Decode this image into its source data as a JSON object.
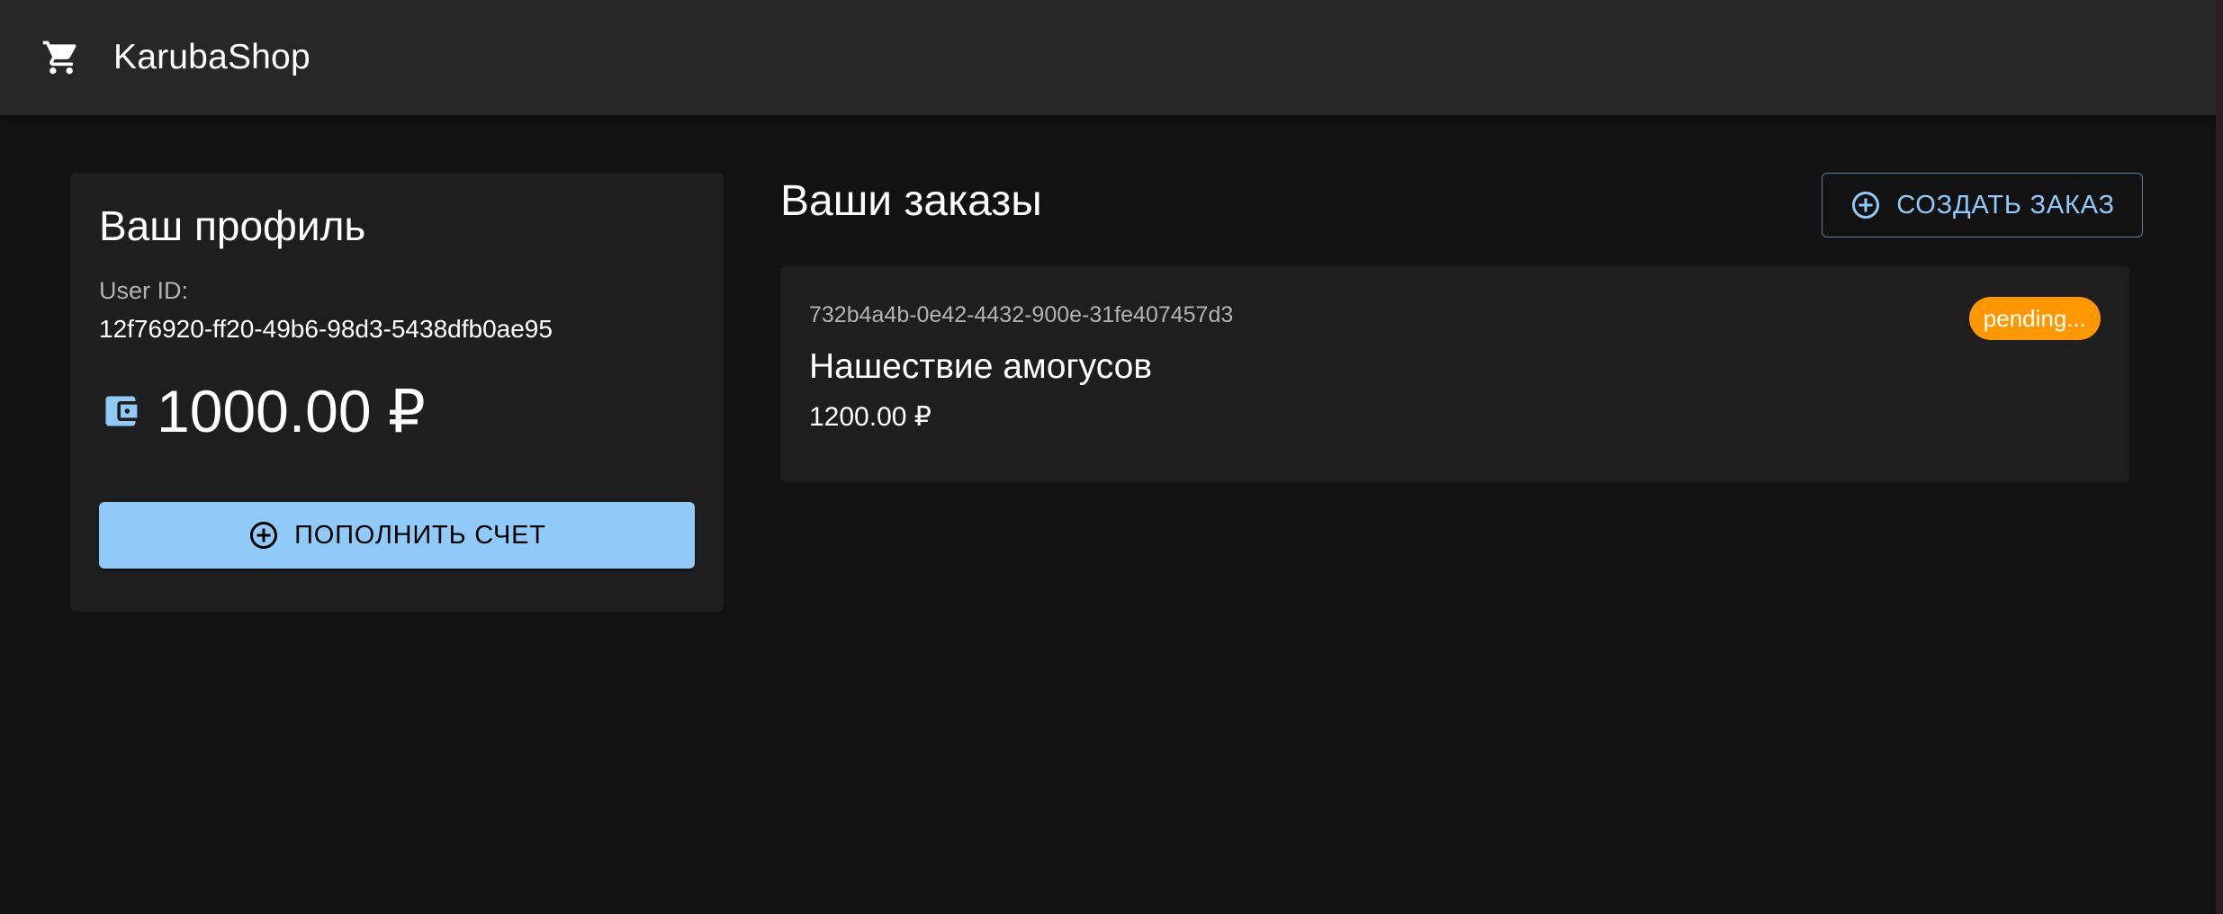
{
  "app": {
    "title": "KarubaShop",
    "icon": "shopping-cart-icon"
  },
  "profile": {
    "heading": "Ваш профиль",
    "user_id_label": "User ID:",
    "user_id": "12f76920-ff20-49b6-98d3-5438dfb0ae95",
    "balance": "1000.00 ₽",
    "balance_icon": "wallet-icon",
    "topup_label": "ПОПОЛНИТЬ СЧЕТ",
    "topup_icon": "add-circle-icon"
  },
  "orders": {
    "heading": "Ваши заказы",
    "create_label": "СОЗДАТЬ ЗАКАЗ",
    "create_icon": "add-circle-icon",
    "items": [
      {
        "id": "732b4a4b-0e42-4432-900e-31fe407457d3",
        "title": "Нашествие амогусов",
        "price": "1200.00 ₽",
        "status": "pending..."
      }
    ]
  },
  "colors": {
    "background": "#121212",
    "appbar": "#272727",
    "card": "#1e1e1e",
    "primary": "#90caf9",
    "status_pending": "#ff9800"
  }
}
